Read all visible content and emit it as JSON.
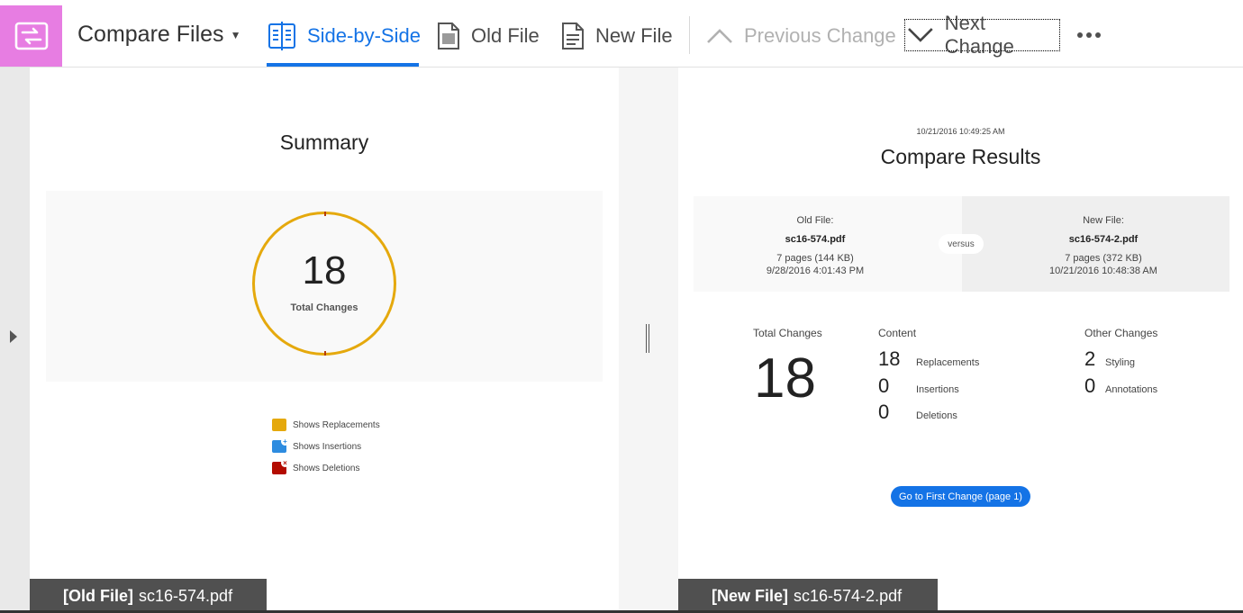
{
  "toolbar": {
    "title": "Compare Files",
    "side_by_side": "Side-by-Side",
    "old_file": "Old File",
    "new_file": "New File",
    "previous_change": "Previous Change",
    "next_change": "Next Change"
  },
  "summary": {
    "title": "Summary",
    "total": "18",
    "total_label": "Total Changes",
    "legend": [
      {
        "label": "Shows Replacements",
        "color": "#e5a90d",
        "icon": "replacement-icon"
      },
      {
        "label": "Shows Insertions",
        "color": "#2d8ce0",
        "icon": "insertion-plus-icon"
      },
      {
        "label": "Shows Deletions",
        "color": "#b30b00",
        "icon": "deletion-x-icon"
      }
    ],
    "ring_color": "#e5a90d"
  },
  "old_file_label": {
    "tag": "[Old File]",
    "name": "sc16-574.pdf"
  },
  "new_file_label": {
    "tag": "[New File]",
    "name": "sc16-574-2.pdf"
  },
  "results": {
    "timestamp": "10/21/2016 10:49:25 AM",
    "title": "Compare Results",
    "old": {
      "label": "Old File:",
      "name": "sc16-574.pdf",
      "pages": "7 pages (144 KB)",
      "date": "9/28/2016 4:01:43 PM"
    },
    "versus": "versus",
    "new": {
      "label": "New File:",
      "name": "sc16-574-2.pdf",
      "pages": "7 pages (372 KB)",
      "date": "10/21/2016 10:48:38 AM"
    },
    "total_changes_heading": "Total Changes",
    "total_changes": "18",
    "content_heading": "Content",
    "content": [
      {
        "count": "18",
        "label": "Replacements"
      },
      {
        "count": "0",
        "label": "Insertions"
      },
      {
        "count": "0",
        "label": "Deletions"
      }
    ],
    "other_heading": "Other Changes",
    "other": [
      {
        "count": "2",
        "label": "Styling"
      },
      {
        "count": "0",
        "label": "Annotations"
      }
    ],
    "go_button": "Go to First Change (page 1)"
  },
  "colors": {
    "accent": "#1473e6",
    "app_tile": "#e77de2",
    "label_bar": "#505050"
  }
}
